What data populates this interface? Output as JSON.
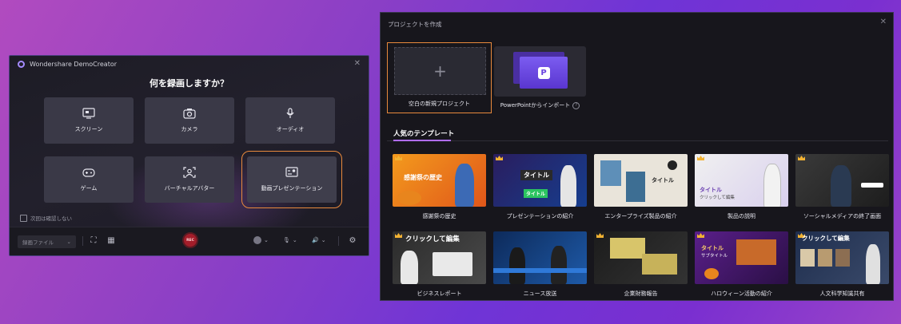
{
  "recorder": {
    "app_title": "Wondershare DemoCreator",
    "heading": "何を録画しますか？",
    "modes": [
      {
        "label": "スクリーン",
        "icon": "screen-icon"
      },
      {
        "label": "カメラ",
        "icon": "camera-icon"
      },
      {
        "label": "オーディオ",
        "icon": "microphone-icon"
      },
      {
        "label": "ゲーム",
        "icon": "gamepad-icon"
      },
      {
        "label": "バーチャルアバター",
        "icon": "avatar-icon"
      },
      {
        "label": "動画プレゼンテーション",
        "icon": "presentation-icon",
        "selected": true
      }
    ],
    "dont_show_label": "次回は確認しない",
    "save_select_value": "録画ファイル",
    "rec_label": "REC"
  },
  "project": {
    "title": "プロジェクトを作成",
    "blank_label": "空白の新規プロジェクト",
    "ppt_label": "PowerPointからインポート",
    "templates_heading": "人気のテンプレート",
    "templates": [
      {
        "label": "感謝祭の歴史",
        "overlay": "感謝祭の歴史",
        "premium": true
      },
      {
        "label": "プレゼンテーションの紹介",
        "overlay": "タイトル",
        "overlay2": "タイトル",
        "premium": true
      },
      {
        "label": "エンタープライズ製品の紹介",
        "overlay": "タイトル",
        "premium": false
      },
      {
        "label": "製品の説明",
        "overlay": "タイトル",
        "overlay2": "クリックして編集",
        "premium": true
      },
      {
        "label": "ソーシャルメディアの終了画面",
        "overlay": "",
        "premium": true
      },
      {
        "label": "ビジネスレポート",
        "overlay": "クリックして編集",
        "premium": true
      },
      {
        "label": "ニュース放送",
        "overlay": "",
        "premium": false
      },
      {
        "label": "企業財務報告",
        "overlay": "",
        "premium": true
      },
      {
        "label": "ハロウィーン活動の紹介",
        "overlay": "タイトル",
        "overlay2": "サブタイトル",
        "premium": true
      },
      {
        "label": "人文科学知識共有",
        "overlay": "クリックして編集",
        "premium": true
      }
    ]
  },
  "colors": {
    "accent_orange": "#e98a3c",
    "accent_purple": "#b06cff",
    "rec_red": "#a31d2a"
  }
}
